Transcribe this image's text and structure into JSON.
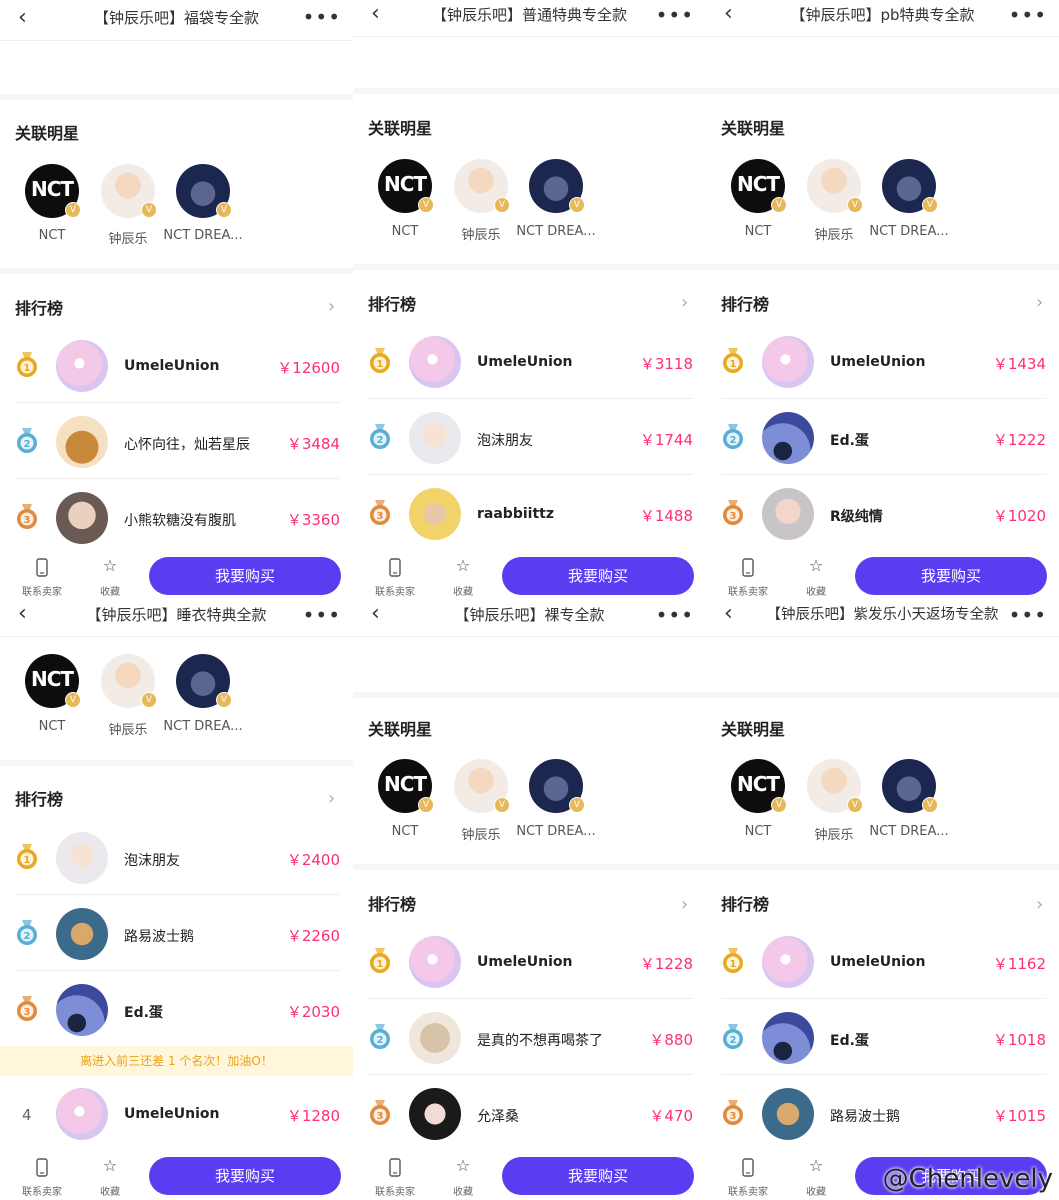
{
  "medal_colors": {
    "1": "#e8a91c",
    "2": "#5aaed6",
    "3": "#e08a3c"
  },
  "accent_color": "#5a3df0",
  "price_color": "#ff2d7a",
  "panels": [
    {
      "title": "【钟辰乐吧】福袋专全款",
      "stars_section": "关联明星",
      "ranking_section": "排行榜",
      "stars": [
        {
          "name": "NCT",
          "icon": "nct-logo"
        },
        {
          "name": "钟辰乐",
          "icon": "chenle-avatar"
        },
        {
          "name": "NCT DREA...",
          "icon": "nct-dream-avatar"
        }
      ],
      "ranks": [
        {
          "name": "UmeleUnion",
          "amount": "￥12600"
        },
        {
          "name": "心怀向往，灿若星辰",
          "amount": "￥3484"
        },
        {
          "name": "小熊软糖没有腹肌",
          "amount": "￥3360"
        }
      ],
      "bottom": {
        "contact": "联系卖家",
        "favorite": "收藏",
        "buy": "我要购买"
      }
    },
    {
      "title": "【钟辰乐吧】普通特典专全款",
      "stars_section": "关联明星",
      "ranking_section": "排行榜",
      "stars": [
        {
          "name": "NCT",
          "icon": "nct-logo"
        },
        {
          "name": "钟辰乐",
          "icon": "chenle-avatar"
        },
        {
          "name": "NCT DREA...",
          "icon": "nct-dream-avatar"
        }
      ],
      "ranks": [
        {
          "name": "UmeleUnion",
          "amount": "￥3118"
        },
        {
          "name": "泡沫朋友",
          "amount": "￥1744"
        },
        {
          "name": "raabbiittz",
          "amount": "￥1488"
        }
      ],
      "bottom": {
        "contact": "联系卖家",
        "favorite": "收藏",
        "buy": "我要购买"
      }
    },
    {
      "title": "【钟辰乐吧】pb特典专全款",
      "stars_section": "关联明星",
      "ranking_section": "排行榜",
      "stars": [
        {
          "name": "NCT",
          "icon": "nct-logo"
        },
        {
          "name": "钟辰乐",
          "icon": "chenle-avatar"
        },
        {
          "name": "NCT DREA...",
          "icon": "nct-dream-avatar"
        }
      ],
      "ranks": [
        {
          "name": "UmeleUnion",
          "amount": "￥1434"
        },
        {
          "name": "Ed.蛋",
          "amount": "￥1222"
        },
        {
          "name": "R级纯情",
          "amount": "￥1020"
        }
      ],
      "bottom": {
        "contact": "联系卖家",
        "favorite": "收藏",
        "buy": "我要购买"
      }
    },
    {
      "title": "【钟辰乐吧】睡衣特典全款",
      "ranking_section": "排行榜",
      "stars": [
        {
          "name": "NCT",
          "icon": "nct-logo"
        },
        {
          "name": "钟辰乐",
          "icon": "chenle-avatar"
        },
        {
          "name": "NCT DREA...",
          "icon": "nct-dream-avatar"
        }
      ],
      "ranks": [
        {
          "name": "泡沫朋友",
          "amount": "￥2400"
        },
        {
          "name": "路易波士鹅",
          "amount": "￥2260"
        },
        {
          "name": "Ed.蛋",
          "amount": "￥2030"
        }
      ],
      "notice": "离进入前三还差 1 个名次！加油O！",
      "rank4": {
        "rank": "4",
        "name": "UmeleUnion",
        "amount": "￥1280"
      },
      "bottom": {
        "contact": "联系卖家",
        "favorite": "收藏",
        "buy": "我要购买"
      }
    },
    {
      "title": "【钟辰乐吧】裸专全款",
      "stars_section": "关联明星",
      "ranking_section": "排行榜",
      "stars": [
        {
          "name": "NCT",
          "icon": "nct-logo"
        },
        {
          "name": "钟辰乐",
          "icon": "chenle-avatar"
        },
        {
          "name": "NCT DREA...",
          "icon": "nct-dream-avatar"
        }
      ],
      "ranks": [
        {
          "name": "UmeleUnion",
          "amount": "￥1228"
        },
        {
          "name": "是真的不想再喝茶了",
          "amount": "￥880"
        },
        {
          "name": "允泽桑",
          "amount": "￥470"
        }
      ],
      "bottom": {
        "contact": "联系卖家",
        "favorite": "收藏",
        "buy": "我要购买"
      }
    },
    {
      "title": "【钟辰乐吧】紫发乐小天返场专全款",
      "stars_section": "关联明星",
      "ranking_section": "排行榜",
      "stars": [
        {
          "name": "NCT",
          "icon": "nct-logo"
        },
        {
          "name": "钟辰乐",
          "icon": "chenle-avatar"
        },
        {
          "name": "NCT DREA...",
          "icon": "nct-dream-avatar"
        }
      ],
      "ranks": [
        {
          "name": "UmeleUnion",
          "amount": "￥1162"
        },
        {
          "name": "Ed.蛋",
          "amount": "￥1018"
        },
        {
          "name": "路易波士鹅",
          "amount": "￥1015"
        }
      ],
      "bottom": {
        "contact": "联系卖家",
        "favorite": "收藏",
        "buy": "我要购买"
      }
    }
  ],
  "watermark": "@Chenlevely"
}
